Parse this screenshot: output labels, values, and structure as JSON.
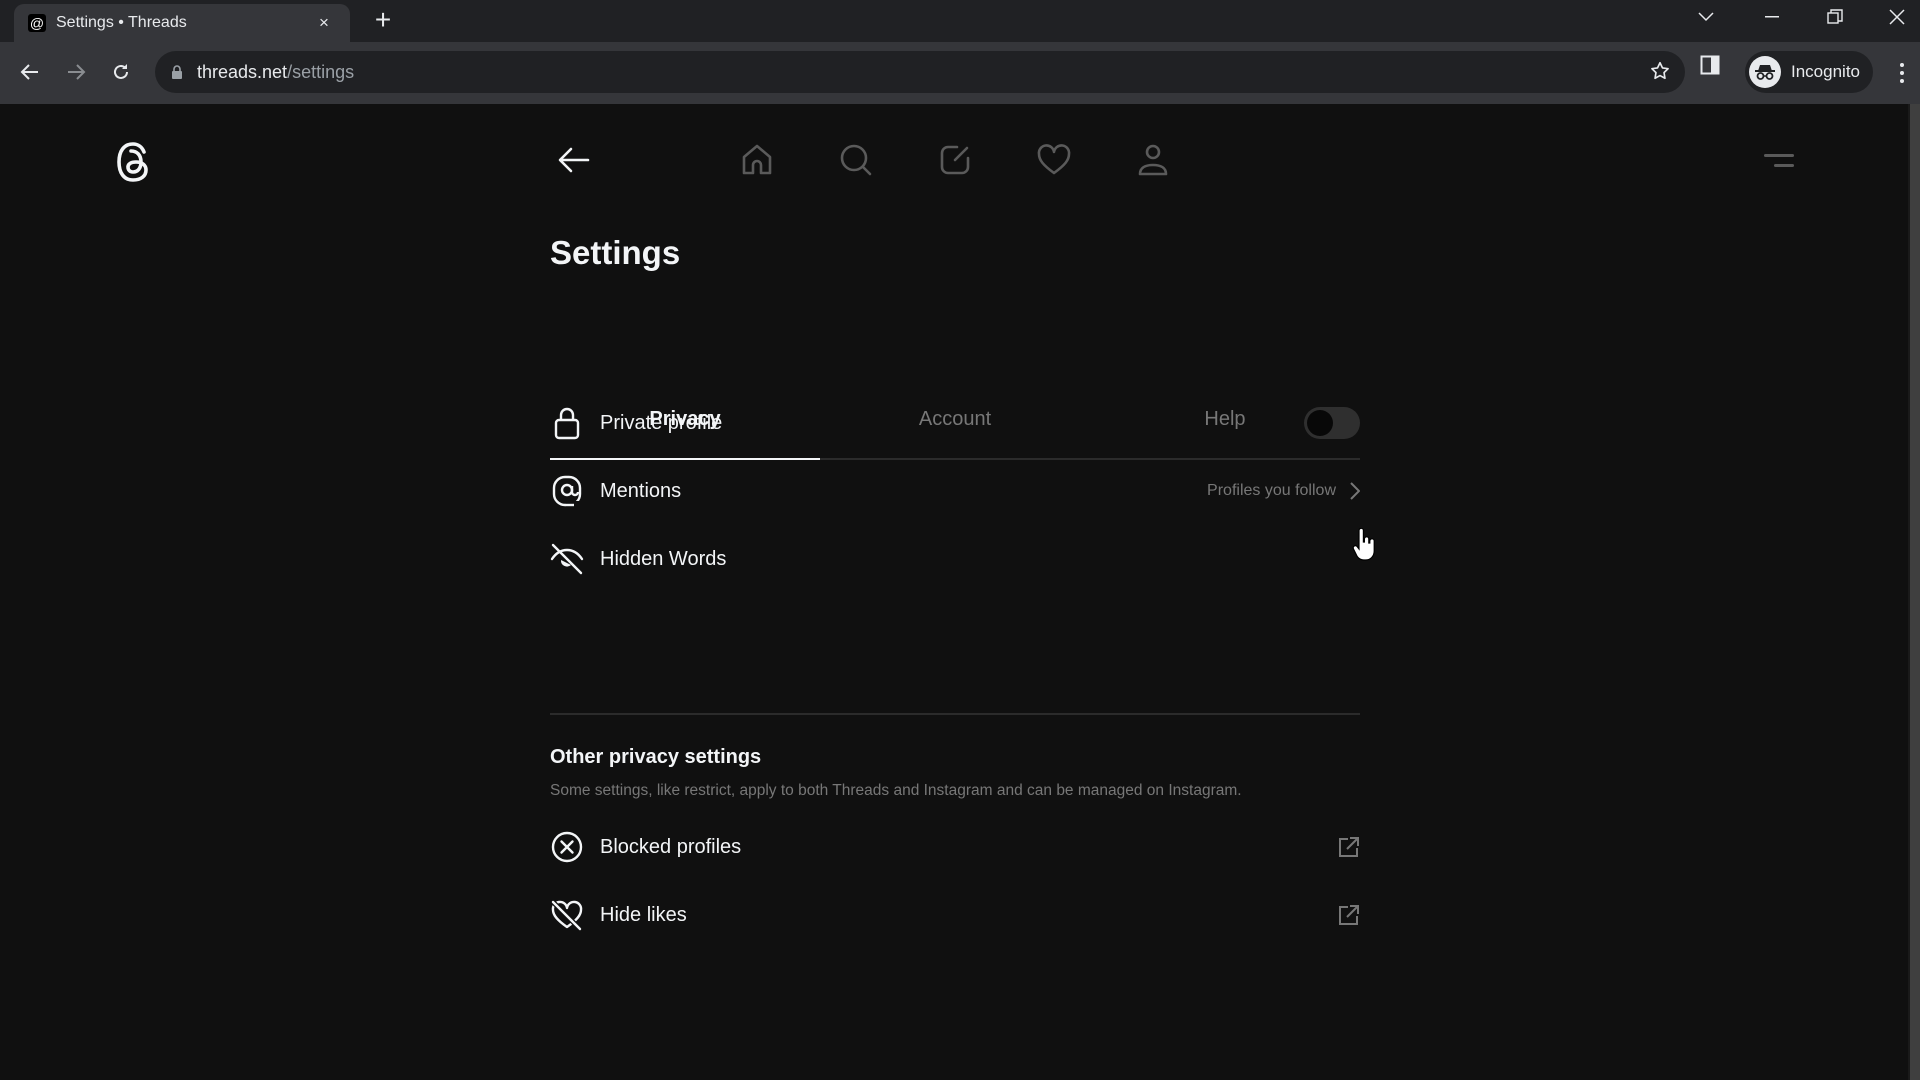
{
  "browser": {
    "tab": {
      "title": "Settings • Threads",
      "favicon": "threads-icon",
      "close": "×"
    },
    "new_tab": "+",
    "url_host": "threads.net",
    "url_path": "/settings",
    "profile_label": "Incognito",
    "window_controls": [
      "tab-search",
      "minimize",
      "restore",
      "close"
    ]
  },
  "topnav": {
    "logo": "threads-logo",
    "back": "back-arrow",
    "icons": [
      "home",
      "search",
      "compose",
      "activity-heart",
      "profile"
    ],
    "menu": "hamburger-menu"
  },
  "settings": {
    "title": "Settings",
    "tabs": [
      {
        "label": "Privacy",
        "active": true
      },
      {
        "label": "Account",
        "active": false
      },
      {
        "label": "Help",
        "active": false
      }
    ],
    "rows": [
      {
        "icon": "lock",
        "label": "Private profile",
        "control": "toggle",
        "value": false
      },
      {
        "icon": "at-sign",
        "label": "Mentions",
        "value_text": "Profiles you follow",
        "control": "chevron"
      },
      {
        "icon": "eye-off",
        "label": "Hidden Words",
        "control": "none"
      }
    ],
    "other": {
      "title": "Other privacy settings",
      "description": "Some settings, like restrict, apply to both Threads and Instagram and can be managed on Instagram.",
      "rows": [
        {
          "icon": "circle-x",
          "label": "Blocked profiles",
          "control": "external-link"
        },
        {
          "icon": "heart-off",
          "label": "Hide likes",
          "control": "external-link"
        }
      ]
    }
  },
  "colors": {
    "page_bg": "#101010",
    "text_primary": "#f3f5f7",
    "text_secondary": "#777777",
    "divider": "#2b2b2b"
  }
}
